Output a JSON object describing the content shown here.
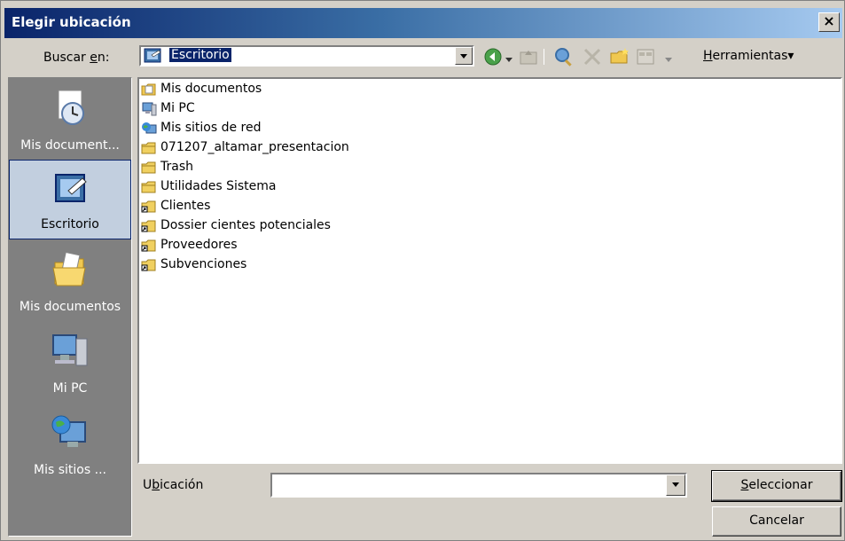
{
  "window": {
    "title": "Elegir ubicación",
    "close_label": "×"
  },
  "look_in": {
    "label_pre": "Buscar ",
    "label_accel": "e",
    "label_post": "n:",
    "value": "Escritorio"
  },
  "toolbar": {
    "tools_accel": "H",
    "tools_rest": "erramientas",
    "tools_arrow": "▾"
  },
  "places": [
    {
      "label": "Mis document...",
      "icon": "recent-documents-icon"
    },
    {
      "label": "Escritorio",
      "icon": "desktop-icon",
      "selected": true
    },
    {
      "label": "Mis documentos",
      "icon": "my-documents-folder-icon"
    },
    {
      "label": "Mi PC",
      "icon": "my-computer-icon"
    },
    {
      "label": "Mis sitios ...",
      "icon": "network-places-icon"
    }
  ],
  "files": [
    {
      "name": "Mis documentos",
      "icon": "my-documents-icon"
    },
    {
      "name": "Mi PC",
      "icon": "my-computer-icon"
    },
    {
      "name": "Mis sitios de red",
      "icon": "network-places-icon"
    },
    {
      "name": "071207_altamar_presentacion",
      "icon": "folder-icon"
    },
    {
      "name": "Trash",
      "icon": "folder-icon"
    },
    {
      "name": "Utilidades Sistema",
      "icon": "folder-icon"
    },
    {
      "name": "Clientes",
      "icon": "folder-shortcut-icon"
    },
    {
      "name": "Dossier cientes potenciales",
      "icon": "folder-shortcut-icon"
    },
    {
      "name": "Proveedores",
      "icon": "folder-shortcut-icon"
    },
    {
      "name": "Subvenciones",
      "icon": "folder-shortcut-icon"
    }
  ],
  "location": {
    "label_pre": "U",
    "label_accel": "b",
    "label_post": "icación",
    "value": ""
  },
  "buttons": {
    "select_accel": "S",
    "select_rest": "eleccionar",
    "cancel": "Cancelar"
  },
  "colors": {
    "titlebar_start": "#0a246a",
    "titlebar_end": "#a6caf0",
    "dialog_bg": "#d4d0c8",
    "selection": "#0a246a"
  }
}
